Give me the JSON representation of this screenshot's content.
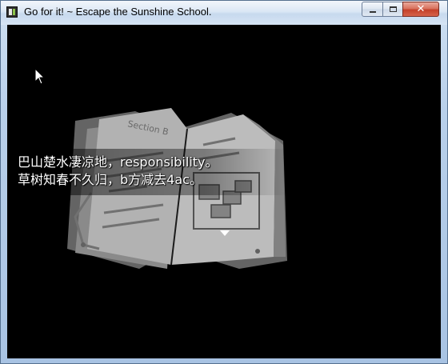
{
  "window": {
    "title": "Go for it! ~ Escape the Sunshine School.",
    "close_symbol": "✕"
  },
  "dialogue": {
    "line1": "巴山楚水凄凉地，responsibility。",
    "line2": "草树知春不久归，b方减去4ac。"
  },
  "book_art": {
    "page_heading": "Section B"
  },
  "icons": {
    "app": "app-icon",
    "cursor": "mouse-cursor-icon",
    "continue": "continue-arrow-icon"
  }
}
